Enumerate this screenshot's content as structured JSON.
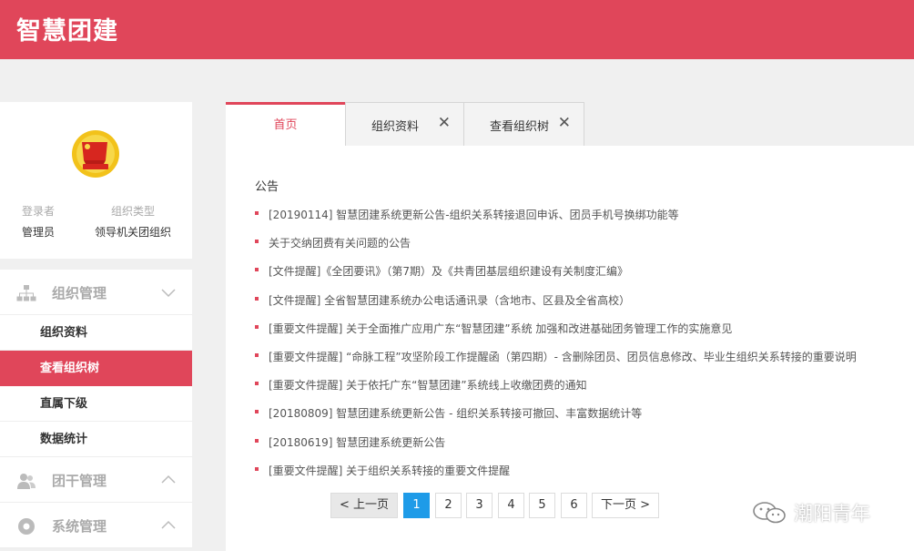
{
  "header": {
    "brand": "智慧团建"
  },
  "profile": {
    "login_label": "登录者",
    "login_value": "管理员",
    "orgtype_label": "组织类型",
    "orgtype_value": "领导机关团组织"
  },
  "menu": {
    "org_mgmt": "组织管理",
    "org_items": [
      "组织资料",
      "查看组织树",
      "直属下级",
      "数据统计"
    ],
    "cadre_mgmt": "团干管理",
    "sys_mgmt": "系统管理"
  },
  "tabs": {
    "home": "首页",
    "org_info": "组织资料",
    "org_tree": "查看组织树",
    "close": "✕"
  },
  "notice": {
    "title": "公告",
    "items": [
      "[20190114] 智慧团建系统更新公告-组织关系转接退回申诉、团员手机号换绑功能等",
      "关于交纳团费有关问题的公告",
      "[文件提醒]《全团要讯》（第7期）及《共青团基层组织建设有关制度汇编》",
      "[文件提醒] 全省智慧团建系统办公电话通讯录（含地市、区县及全省高校）",
      "[重要文件提醒] 关于全面推广应用广东“智慧团建”系统 加强和改进基础团务管理工作的实施意见",
      "[重要文件提醒] “命脉工程”攻坚阶段工作提醒函（第四期）- 含删除团员、团员信息修改、毕业生组织关系转接的重要说明",
      "[重要文件提醒] 关于依托广东“智慧团建”系统线上收缴团费的通知",
      "[20180809] 智慧团建系统更新公告 - 组织关系转接可撤回、丰富数据统计等",
      "[20180619] 智慧团建系统更新公告",
      "[重要文件提醒] 关于组织关系转接的重要文件提醒"
    ]
  },
  "pager": {
    "prev": "< 上一页",
    "pages": [
      "1",
      "2",
      "3",
      "4",
      "5",
      "6"
    ],
    "next": "下一页 >",
    "current": "1"
  },
  "watermark": {
    "text": "潮阳青年"
  },
  "colors": {
    "accent": "#e0465a",
    "pager_active": "#1e9be8"
  }
}
